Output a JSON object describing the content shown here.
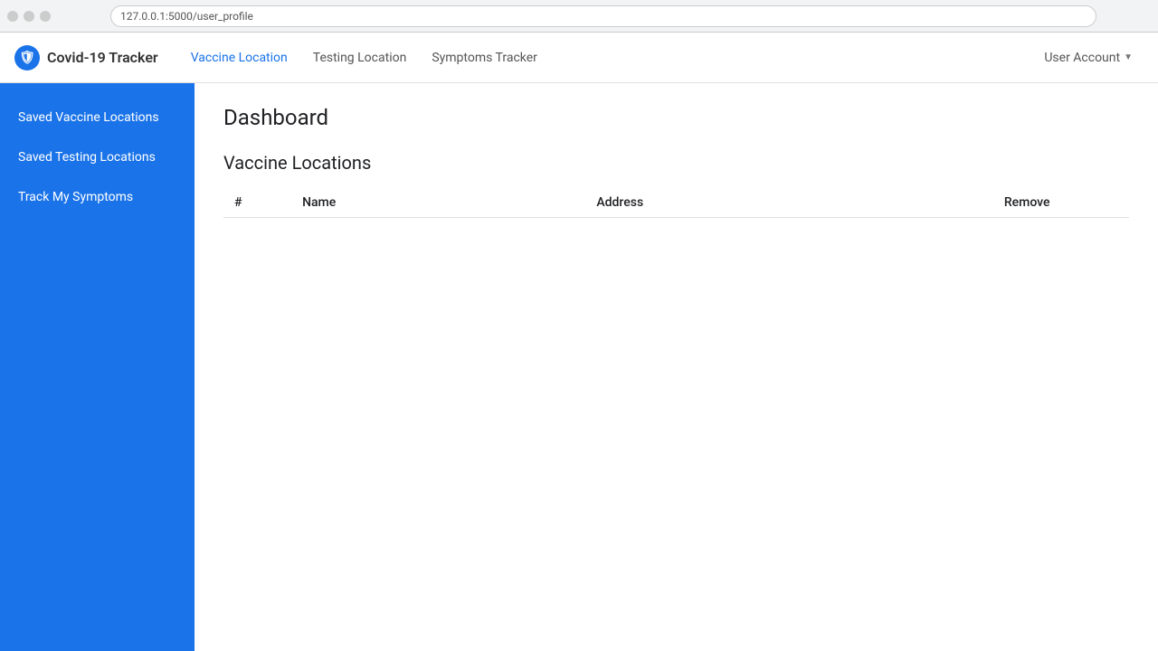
{
  "browser": {
    "url": "127.0.0.1:5000/user_profile"
  },
  "navbar": {
    "brand": "Covid-19 Tracker",
    "brand_icon": "🛡️",
    "nav_items": [
      {
        "label": "Vaccine Location",
        "active": true
      },
      {
        "label": "Testing Location",
        "active": false
      },
      {
        "label": "Symptoms Tracker",
        "active": false
      }
    ],
    "user_account": "User Account"
  },
  "sidebar": {
    "items": [
      {
        "label": "Saved Vaccine Locations"
      },
      {
        "label": "Saved Testing Locations"
      },
      {
        "label": "Track My Symptoms"
      }
    ]
  },
  "content": {
    "page_title": "Dashboard",
    "section_title": "Vaccine Locations",
    "table": {
      "columns": [
        "#",
        "Name",
        "Address",
        "Remove"
      ],
      "rows": []
    }
  }
}
